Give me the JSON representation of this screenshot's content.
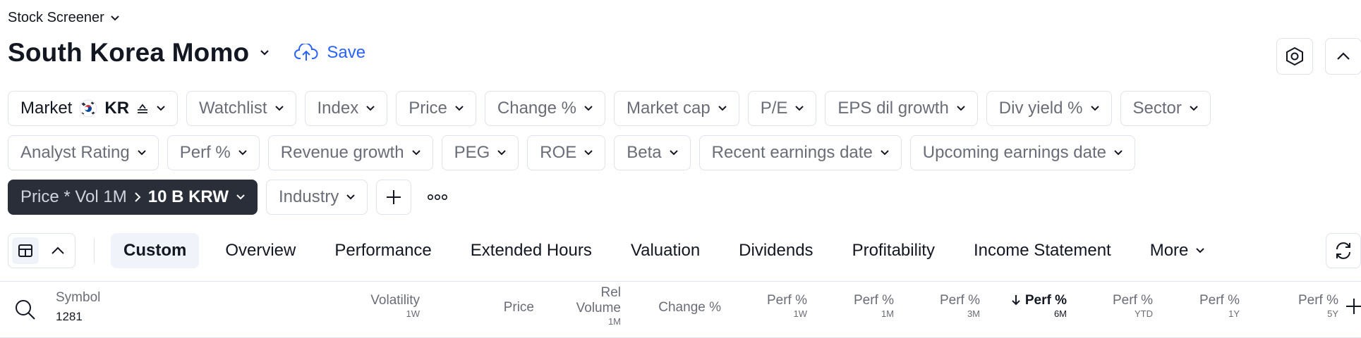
{
  "breadcrumb": {
    "label": "Stock Screener"
  },
  "header": {
    "title": "South Korea Momo",
    "save_label": "Save"
  },
  "filters": {
    "row1": {
      "market_label": "Market",
      "market_value": "KR",
      "items": [
        "Watchlist",
        "Index",
        "Price",
        "Change %",
        "Market cap",
        "P/E",
        "EPS dil growth",
        "Div yield %",
        "Sector"
      ]
    },
    "row2": {
      "items": [
        "Analyst Rating",
        "Perf %",
        "Revenue growth",
        "PEG",
        "ROE",
        "Beta",
        "Recent earnings date",
        "Upcoming earnings date"
      ]
    },
    "row3": {
      "active_filter_label": "Price * Vol 1M",
      "active_filter_value": "10 B KRW",
      "industry_label": "Industry"
    }
  },
  "tabs": {
    "selected": "Custom",
    "items": [
      "Custom",
      "Overview",
      "Performance",
      "Extended Hours",
      "Valuation",
      "Dividends",
      "Profitability",
      "Income Statement",
      "More"
    ]
  },
  "table": {
    "symbol_header": "Symbol",
    "symbol_count": "1281",
    "columns": [
      {
        "l1": "Volatility",
        "l2": "",
        "sub": "1W"
      },
      {
        "l1": "Price",
        "l2": "",
        "sub": ""
      },
      {
        "l1": "Rel",
        "l2": "Volume",
        "sub": "1M"
      },
      {
        "l1": "Change %",
        "l2": "",
        "sub": ""
      },
      {
        "l1": "Perf %",
        "l2": "",
        "sub": "1W"
      },
      {
        "l1": "Perf %",
        "l2": "",
        "sub": "1M"
      },
      {
        "l1": "Perf %",
        "l2": "",
        "sub": "3M"
      },
      {
        "l1": "Perf %",
        "l2": "",
        "sub": "6M",
        "sorted": "desc"
      },
      {
        "l1": "Perf %",
        "l2": "",
        "sub": "YTD"
      },
      {
        "l1": "Perf %",
        "l2": "",
        "sub": "1Y"
      },
      {
        "l1": "Perf %",
        "l2": "",
        "sub": "5Y"
      }
    ]
  },
  "icons": {
    "settings": "hexagon-settings-icon",
    "collapse": "chevron-up-icon",
    "refresh": "refresh-icon",
    "search": "search-icon",
    "save": "cloud-upload-icon"
  },
  "colors": {
    "accent": "#2962ff",
    "text": "#131722",
    "muted": "#6a6d78",
    "border": "#e0e3eb",
    "dark_chip": "#2a2e39"
  }
}
